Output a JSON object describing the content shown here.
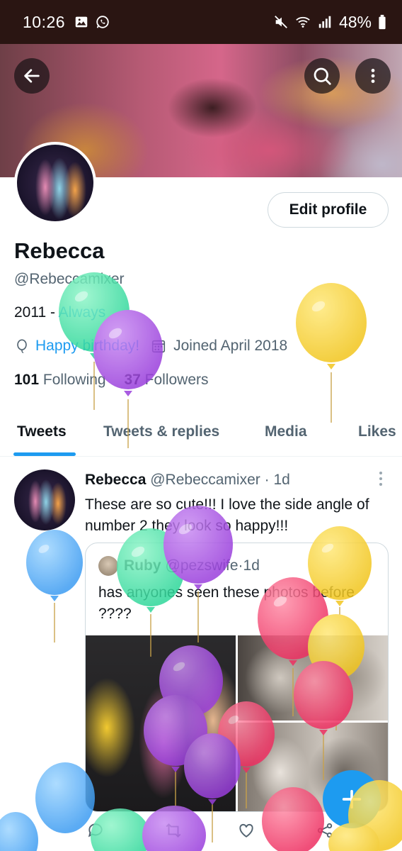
{
  "status_bar": {
    "time": "10:26",
    "battery": "48%",
    "icons": [
      "gallery-icon",
      "whatsapp-icon",
      "mute-icon",
      "wifi-icon",
      "signal-icon",
      "battery-icon"
    ]
  },
  "header": {
    "back_icon": "back-arrow-icon",
    "search_icon": "search-icon",
    "more_icon": "more-vertical-icon"
  },
  "profile": {
    "edit_button": "Edit profile",
    "name": "Rebecca",
    "handle": "@Rebeccamixer",
    "bio_prefix": "2011 - ",
    "bio_link": "Always",
    "birthday": "Happy birthday!",
    "joined": "Joined April 2018",
    "following_count": "101",
    "following_label": "Following",
    "followers_count": "37",
    "followers_label": "Followers"
  },
  "tabs": [
    {
      "label": "Tweets",
      "active": true
    },
    {
      "label": "Tweets & replies",
      "active": false
    },
    {
      "label": "Media",
      "active": false
    },
    {
      "label": "Likes",
      "active": false
    }
  ],
  "tweet": {
    "author": "Rebecca",
    "handle": "@Rebeccamixer",
    "separator": " · ",
    "time": "1d",
    "text": "These are so cute!!! I love the side angle of number 2 they look so happy!!!",
    "quote": {
      "author": "Ruby",
      "handle": "@pezswife",
      "time": "1d",
      "text": "has anyones seen these photos before ????"
    }
  },
  "fab_icon": "plus-icon",
  "colors": {
    "accent": "#1d9bf0",
    "text": "#0f1419",
    "muted": "#536471",
    "status_bar_bg": "#2a1512"
  }
}
